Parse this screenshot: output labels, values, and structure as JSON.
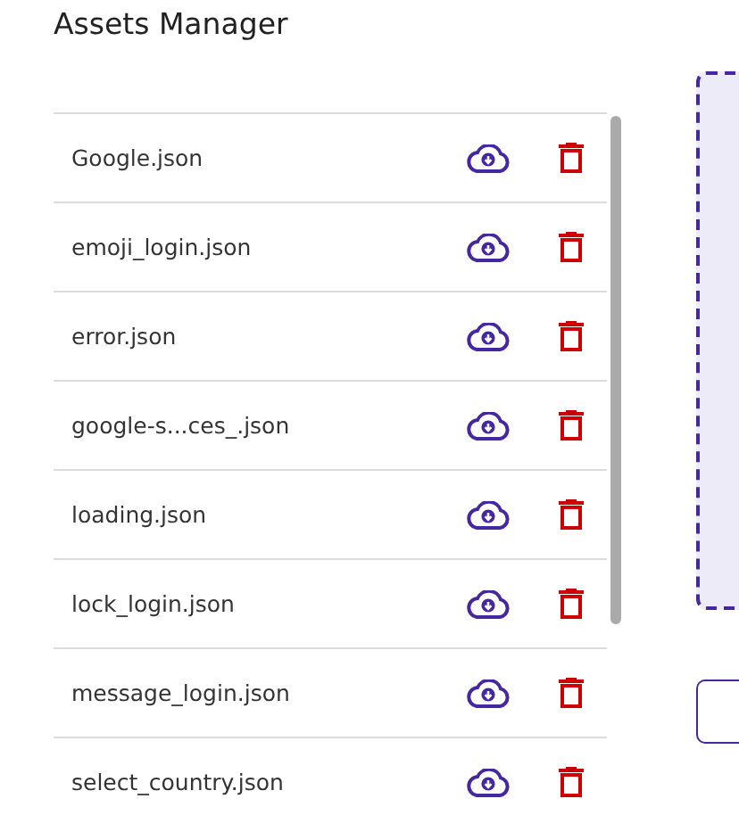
{
  "title": "Assets Manager",
  "files": [
    {
      "name": "Google.json"
    },
    {
      "name": "emoji_login.json"
    },
    {
      "name": "error.json"
    },
    {
      "name": "google-s...ces_.json"
    },
    {
      "name": "loading.json"
    },
    {
      "name": "lock_login.json"
    },
    {
      "name": "message_login.json"
    },
    {
      "name": "select_country.json"
    }
  ]
}
